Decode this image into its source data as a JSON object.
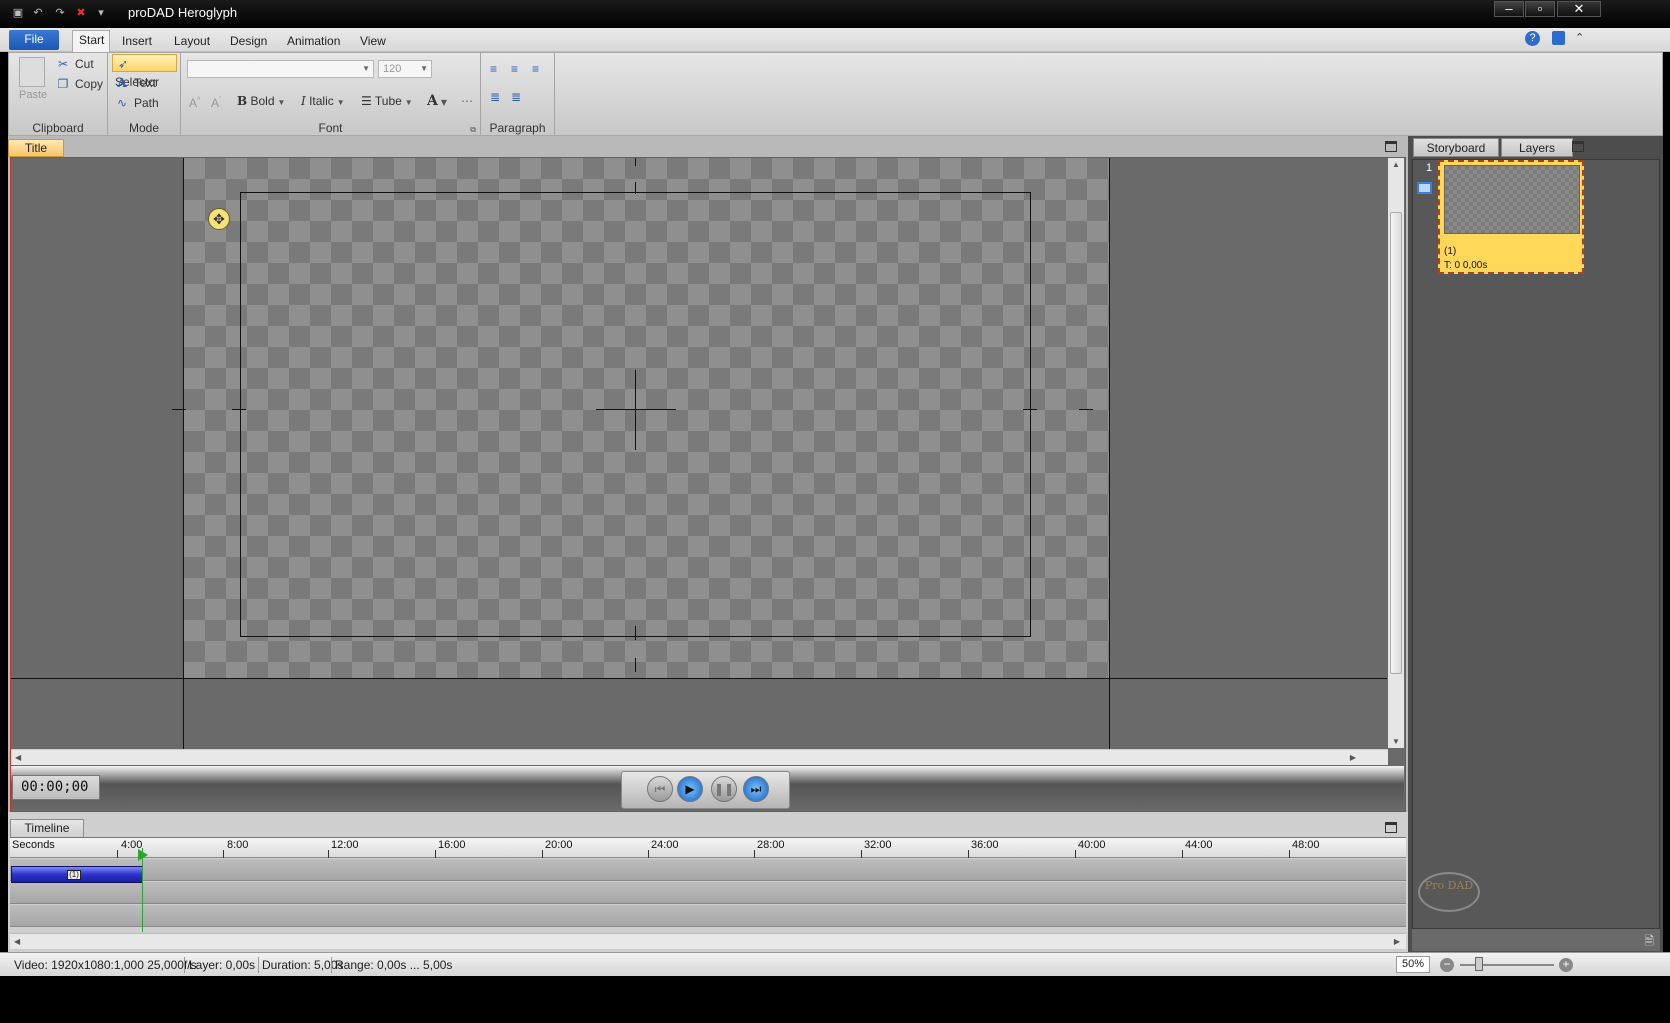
{
  "window": {
    "title": "proDAD Heroglyph"
  },
  "ribbon": {
    "tabs": {
      "file": "File",
      "start": "Start",
      "insert": "Insert",
      "layout": "Layout",
      "design": "Design",
      "animation": "Animation",
      "view": "View"
    },
    "clipboard": {
      "label": "Clipboard",
      "paste": "Paste",
      "cut": "Cut",
      "copy": "Copy"
    },
    "mode": {
      "label": "Mode",
      "selector": "Selector",
      "text": "Text",
      "path": "Path"
    },
    "font": {
      "label": "Font",
      "font_name": "",
      "font_size": "120",
      "bold": "Bold",
      "italic": "Italic",
      "outline": "Tube"
    },
    "paragraph": {
      "label": "Paragraph"
    }
  },
  "document": {
    "tab": "Title",
    "timecode": "00:00;00"
  },
  "timeline": {
    "tab": "Timeline",
    "ruler_unit": "Seconds",
    "ticks": [
      "4:00",
      "8:00",
      "12:00",
      "16:00",
      "20:00",
      "24:00",
      "28:00",
      "32:00",
      "36:00",
      "40:00",
      "44:00",
      "48:00"
    ],
    "clip_label": "(1)"
  },
  "side_panel": {
    "tabs": {
      "storyboard": "Storyboard",
      "layers": "Layers"
    },
    "scene": {
      "index": "1",
      "name": "(1)",
      "time": "T: 0  0,00s"
    },
    "logo": "Pro DAD"
  },
  "status": {
    "video": "Video: 1920x1080:1,000  25,000f/s",
    "layer": "Layer: 0,00s",
    "duration": "Duration: 5,00s",
    "range": "Range: 0,00s ... 5,00s",
    "zoom": "50%"
  }
}
